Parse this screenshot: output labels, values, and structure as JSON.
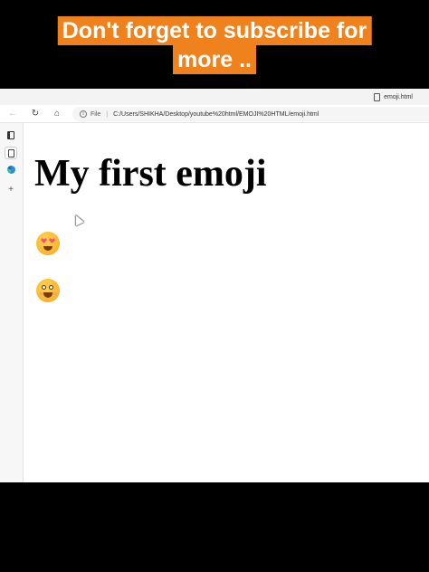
{
  "caption": {
    "line1": "Don't forget to subscribe for",
    "line2": "more .."
  },
  "browser": {
    "tab_title": "emoji.html",
    "address": {
      "scheme_label": "File",
      "url": "C:/Users/SHIKHA/Desktop/youtube%20html/EMOJI%20HTML/emoji.html"
    },
    "sidebar": {
      "items": [
        "tab-actions",
        "page",
        "edge",
        "add"
      ],
      "add_label": "+"
    }
  },
  "page": {
    "heading": "My first emoji",
    "emojis": [
      "smiling-face-with-heart-eyes",
      "grinning-face-with-blush"
    ]
  },
  "colors": {
    "caption_bg": "#f0821e",
    "caption_text": "#ffffff",
    "letterbox": "#000000"
  }
}
